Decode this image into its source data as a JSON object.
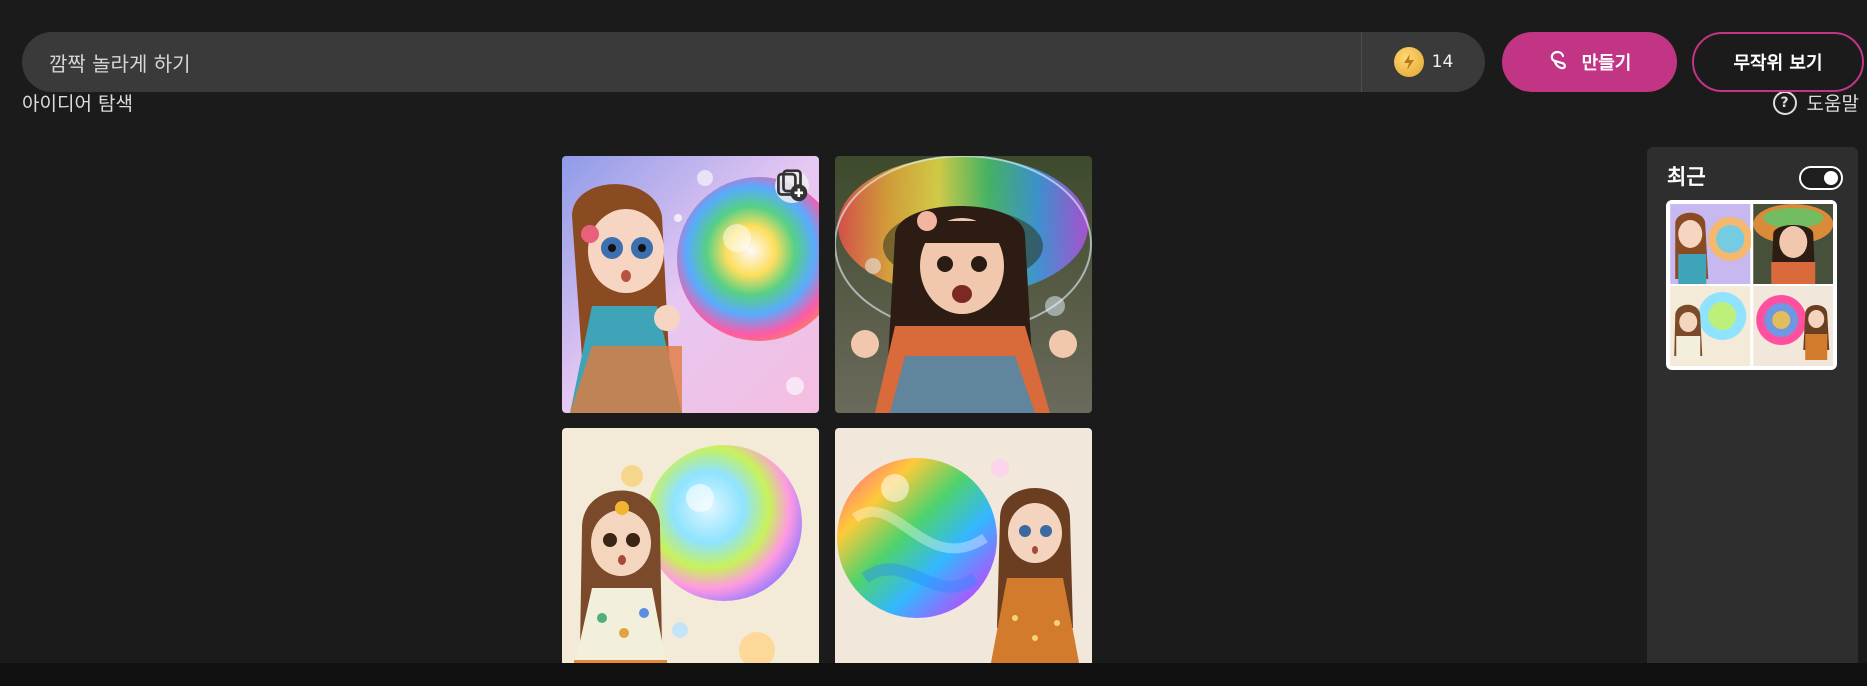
{
  "search": {
    "value": "깜짝 놀라게 하기",
    "placeholder": "깜짝 놀라게 하기"
  },
  "coins": {
    "count": "14",
    "icon": "bolt-coin-icon",
    "color": "#f2b93c"
  },
  "buttons": {
    "create_label": "만들기",
    "random_label": "무작위 보기"
  },
  "clipped_row": {
    "left_text": "아이디어 탐색",
    "right_text": "도움말"
  },
  "images": [
    {
      "name": "girl-with-flower-and-rainbow-bubble"
    },
    {
      "name": "girl-under-giant-rainbow-bubble"
    },
    {
      "name": "cartoon-girl-polka-dot-dress-bubble"
    },
    {
      "name": "cartoon-girl-orange-dress-swirl-bubble"
    }
  ],
  "recent": {
    "title": "최근",
    "toggle_on": true
  },
  "colors": {
    "background": "#1b1b1b",
    "search_bar": "#3a3a3a",
    "accent": "#c13584",
    "panel": "#2e2e2e"
  }
}
